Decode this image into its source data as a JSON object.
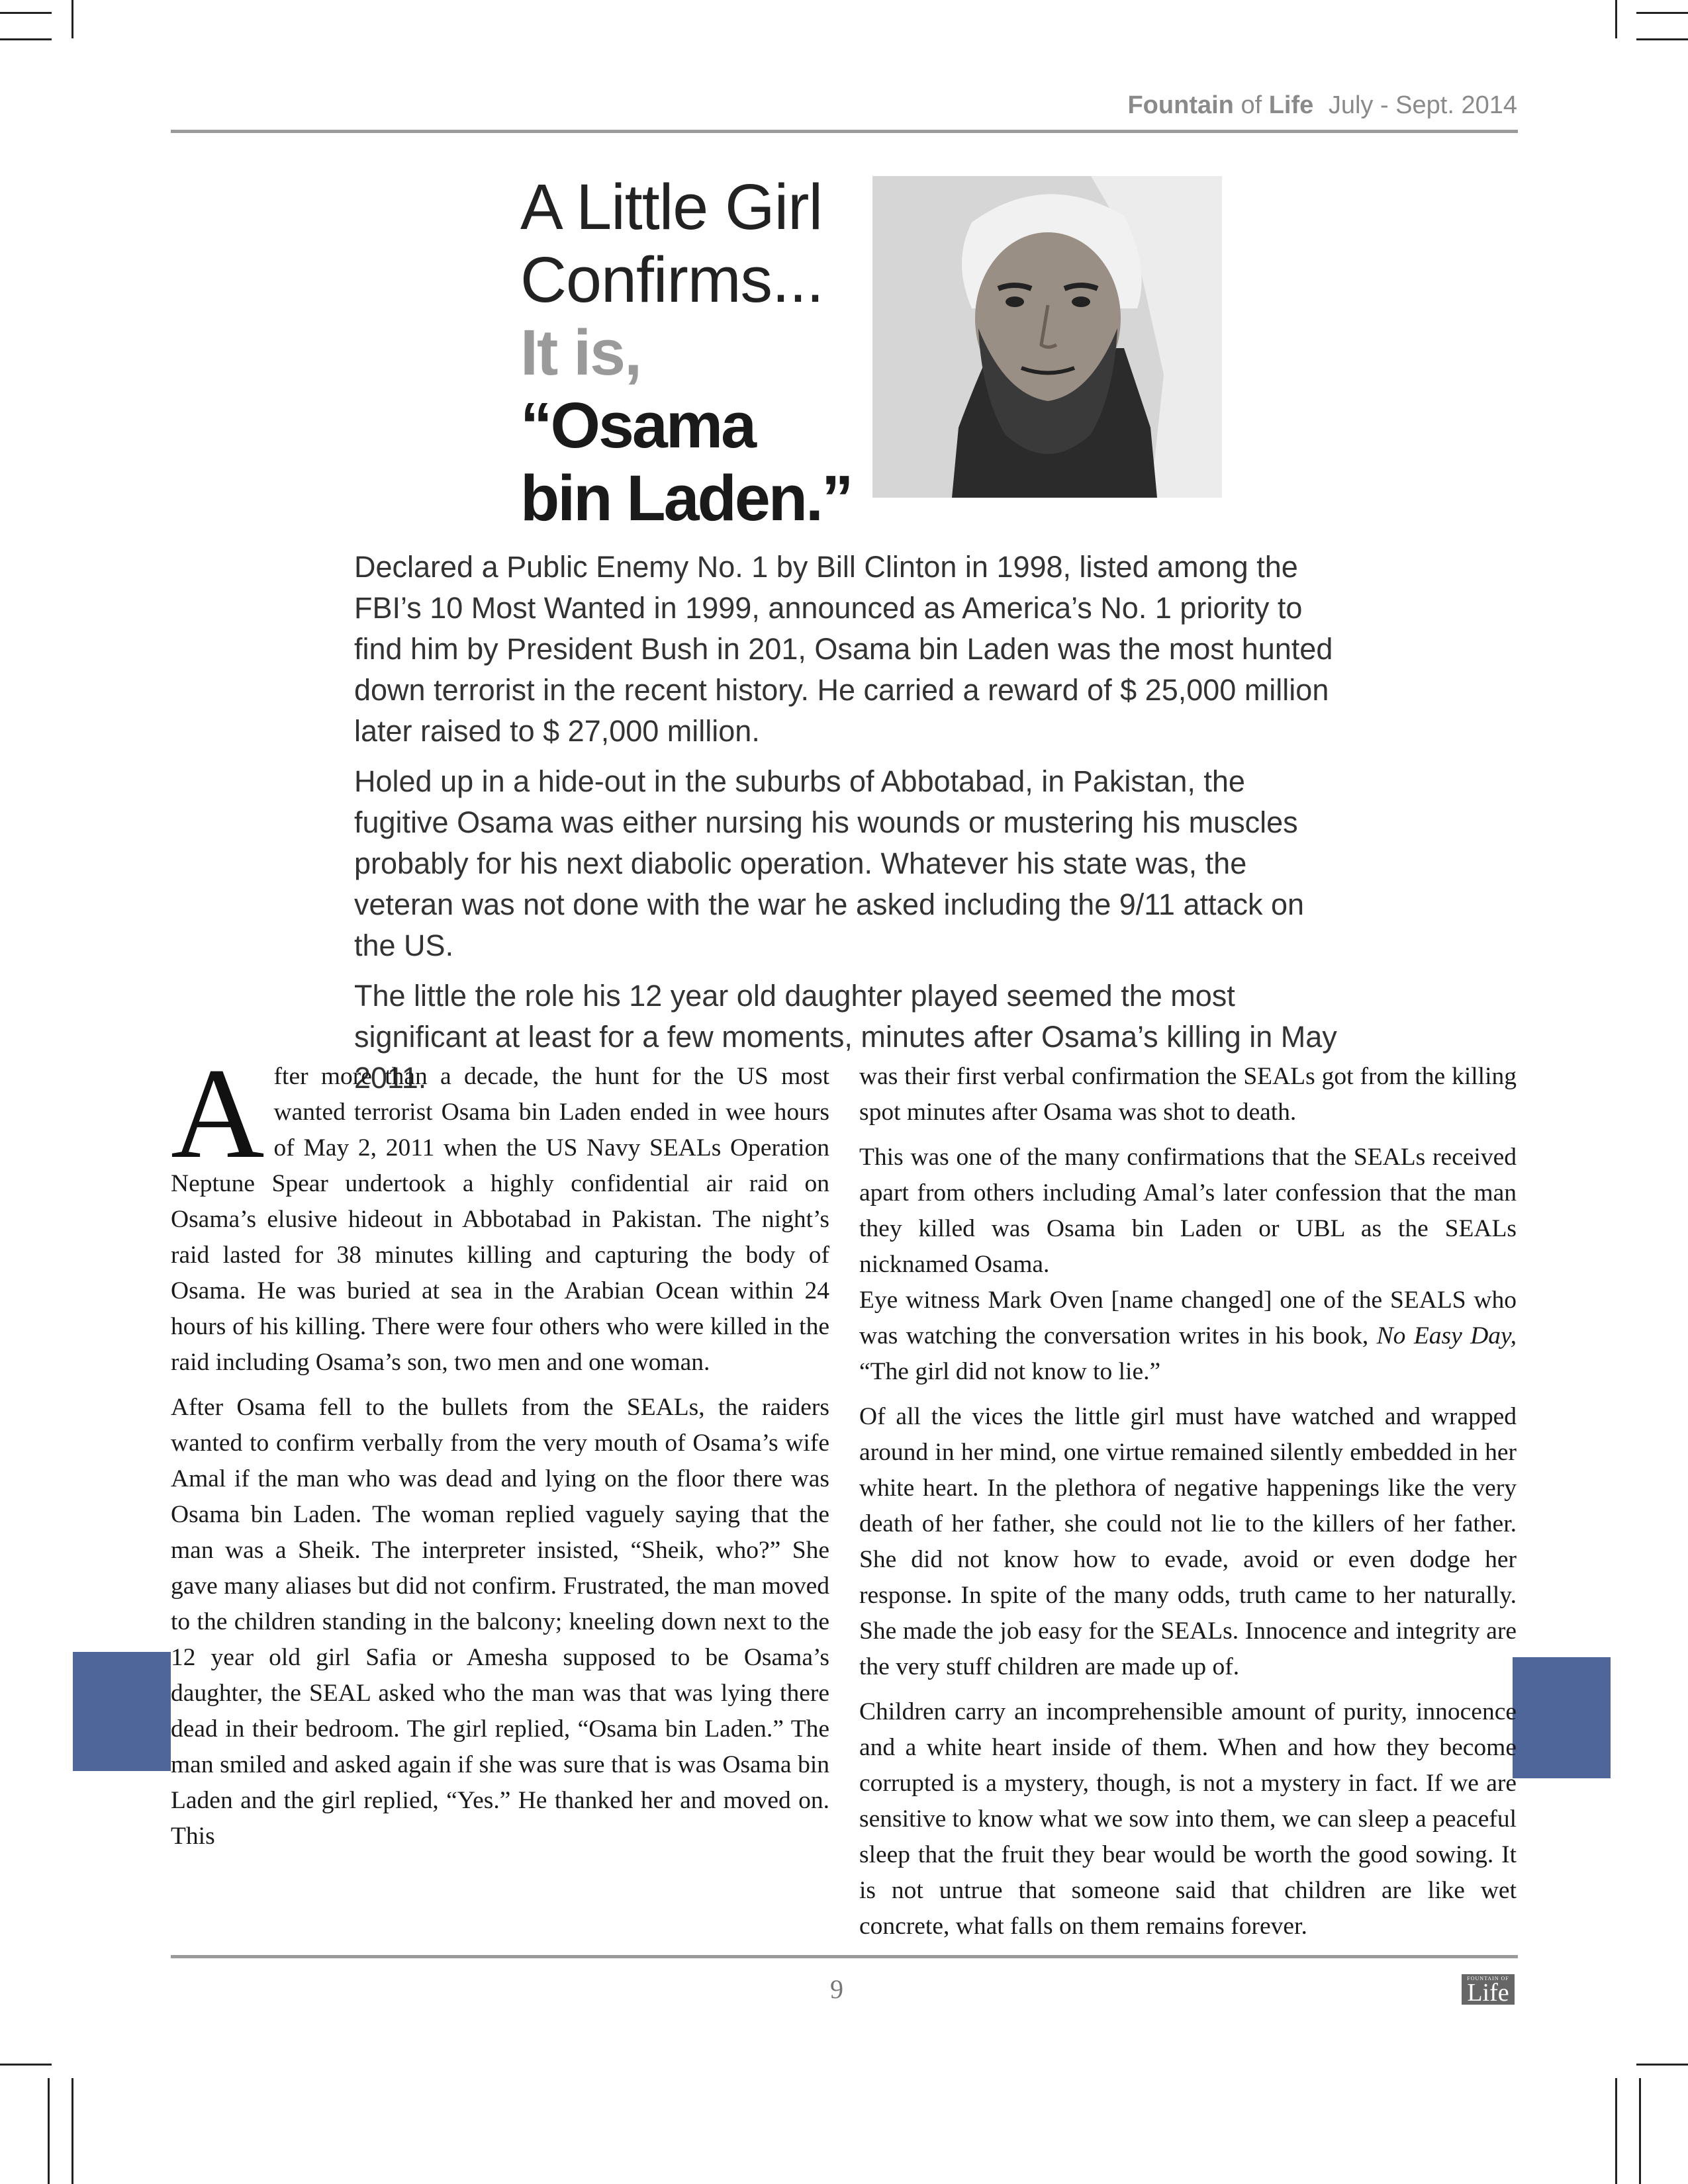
{
  "header": {
    "brand_bold": "Fountain",
    "brand_of": "of",
    "brand_life": "Life",
    "issue": "July - Sept. 2014"
  },
  "title": {
    "line1": "A Little Girl",
    "line2": "Confirms...",
    "line3": "It is,",
    "line4": "“Osama",
    "line5": "bin Laden.”"
  },
  "intro": [
    "Declared a Public Enemy No. 1  by Bill Clinton in 1998, listed among the FBI’s 10 Most Wanted in 1999, announced as America’s No. 1 priority to find him by President Bush in 201, Osama bin Laden was the most hunted down terrorist in the recent history. He carried a reward of $ 25,000 million later raised to $ 27,000 million.",
    "Holed up in a hide-out in the suburbs of Abbotabad, in Pakistan, the fugitive Osama was either nursing his wounds or mustering his muscles probably for his next diabolic operation. Whatever his state was, the veteran was not done with the war he asked including the 9/11 attack on the US.",
    "The little the role his 12 year old daughter played seemed the most significant at least for a few moments, minutes after Osama’s killing in May 2011."
  ],
  "article": {
    "dropcap": "A",
    "col1": [
      "fter more than a decade, the hunt for the US most wanted terrorist Osama bin Laden ended in wee hours of May 2, 2011 when the US Navy SEALs Operation Neptune Spear undertook a highly confidential air raid on Osama’s elusive hideout in Abbotabad in Pakistan.  The night’s raid lasted for 38 minutes killing and capturing the body of Osama.  He was buried at sea in the Arabian Ocean within 24 hours of his killing. There were four others who were killed in the raid including Osama’s son, two men and one woman.",
      "After Osama fell to the bullets from the SEALs, the raiders wanted to confirm verbally from the very mouth of Osama’s wife Amal if the man who was dead and lying on the floor there was Osama bin Laden. The woman replied vaguely saying that the man was a Sheik. The interpreter insisted, “Sheik, who?” She gave many aliases but did not confirm. Frustrated, the man moved to the children standing in the balcony; kneeling down next to the 12 year old girl Safia or Amesha supposed to be Osama’s daughter, the SEAL asked who the man was that was lying there dead in their bedroom. The girl replied, “Osama bin Laden.” The man smiled and asked again if she was sure that is was Osama bin Laden and the girl replied, “Yes.” He thanked her and moved on. This"
    ],
    "col2_p1": "was their first verbal confirmation the SEALs got from the killing spot minutes after Osama was shot to death.",
    "col2_p2": "This was one of the many confirmations that the SEALs received apart from others including Amal’s later confession that the man they killed was Osama bin Laden or UBL as the SEALs nicknamed Osama.",
    "col2_p3_a": "Eye witness Mark Oven [name changed] one of the SEALS who was watching the conversation writes in his book, ",
    "col2_p3_book": "No Easy Day,",
    "col2_p3_b": " “The girl did not know to lie.”",
    "col2_p4": "Of all the vices the little girl must have watched and wrapped around in her mind, one virtue remained silently embedded in her white heart. In the plethora of negative happenings like the very death of her father, she could not lie to the killers of her father. She did not know how to evade, avoid or even dodge her response. In spite of the many odds, truth came to her naturally. She made the job easy for the SEALs. Innocence and integrity are the very stuff children are made up of.",
    "col2_p5": "Children carry an incomprehensible amount of purity, innocence and a white heart inside of them. When and how they become corrupted is a mystery, though, is not a mystery in fact. If we are sensitive to know what we sow into them, we can sleep a peaceful sleep that the fruit they bear would be worth the good sowing. It is not untrue that someone said that children are like wet concrete, what falls on them remains forever."
  },
  "footer": {
    "page_number": "9",
    "logo_small": "FOUNTAIN OF",
    "logo_big": "Life"
  },
  "colors": {
    "accent_blue": "#4f669a",
    "rule_grey": "#9a9a9a"
  }
}
